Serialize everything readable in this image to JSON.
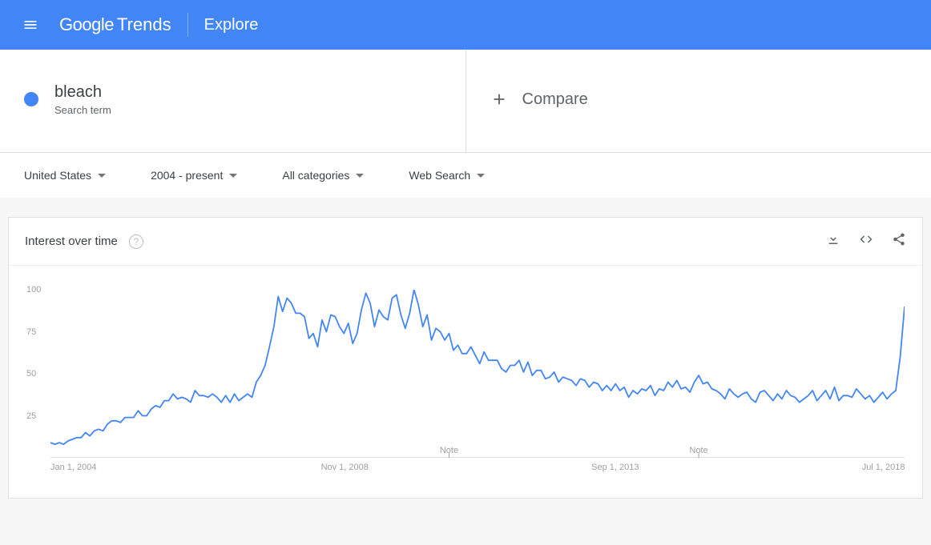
{
  "header": {
    "logo_g": "Google",
    "logo_t": "Trends",
    "nav": "Explore"
  },
  "terms": {
    "term1": {
      "name": "bleach",
      "type": "Search term"
    },
    "compare_label": "Compare"
  },
  "filters": {
    "region": "United States",
    "time": "2004 - present",
    "category": "All categories",
    "search_type": "Web Search"
  },
  "chart": {
    "title": "Interest over time",
    "help": "?",
    "note_label": "Note"
  },
  "chart_data": {
    "type": "line",
    "title": "Interest over time",
    "ylabel": "",
    "xlabel": "",
    "ylim": [
      0,
      100
    ],
    "y_ticks": [
      25,
      50,
      75,
      100
    ],
    "x_tick_labels": [
      "Jan 1, 2004",
      "Nov 1, 2008",
      "Sep 1, 2013",
      "Jul 1, 2018"
    ],
    "notes_at_indices": [
      91,
      148
    ],
    "series": [
      {
        "name": "bleach",
        "color": "#4285f4",
        "values": [
          9,
          8,
          9,
          8,
          10,
          11,
          12,
          12,
          15,
          13,
          16,
          17,
          16,
          20,
          22,
          22,
          21,
          24,
          24,
          24,
          28,
          25,
          25,
          29,
          31,
          30,
          34,
          34,
          38,
          35,
          36,
          35,
          33,
          40,
          37,
          37,
          36,
          38,
          36,
          33,
          37,
          33,
          38,
          34,
          36,
          38,
          36,
          45,
          49,
          55,
          66,
          78,
          96,
          87,
          95,
          92,
          86,
          86,
          84,
          71,
          74,
          66,
          82,
          75,
          85,
          84,
          78,
          74,
          80,
          68,
          74,
          88,
          98,
          92,
          78,
          88,
          84,
          82,
          95,
          97,
          85,
          77,
          86,
          100,
          91,
          78,
          85,
          70,
          77,
          75,
          70,
          74,
          64,
          67,
          62,
          62,
          66,
          61,
          56,
          63,
          58,
          58,
          58,
          53,
          51,
          55,
          55,
          58,
          51,
          57,
          49,
          52,
          52,
          47,
          48,
          51,
          45,
          48,
          47,
          46,
          43,
          47,
          46,
          42,
          45,
          44,
          40,
          43,
          40,
          44,
          40,
          42,
          36,
          40,
          38,
          41,
          40,
          43,
          37,
          41,
          40,
          45,
          42,
          46,
          41,
          42,
          39,
          45,
          49,
          44,
          45,
          41,
          40,
          38,
          35,
          41,
          38,
          36,
          38,
          39,
          35,
          33,
          39,
          40,
          37,
          34,
          38,
          35,
          40,
          37,
          36,
          33,
          35,
          37,
          40,
          34,
          37,
          40,
          35,
          42,
          34,
          37,
          37,
          36,
          41,
          38,
          35,
          37,
          33,
          36,
          39,
          35,
          38,
          40,
          60,
          90
        ]
      }
    ]
  }
}
